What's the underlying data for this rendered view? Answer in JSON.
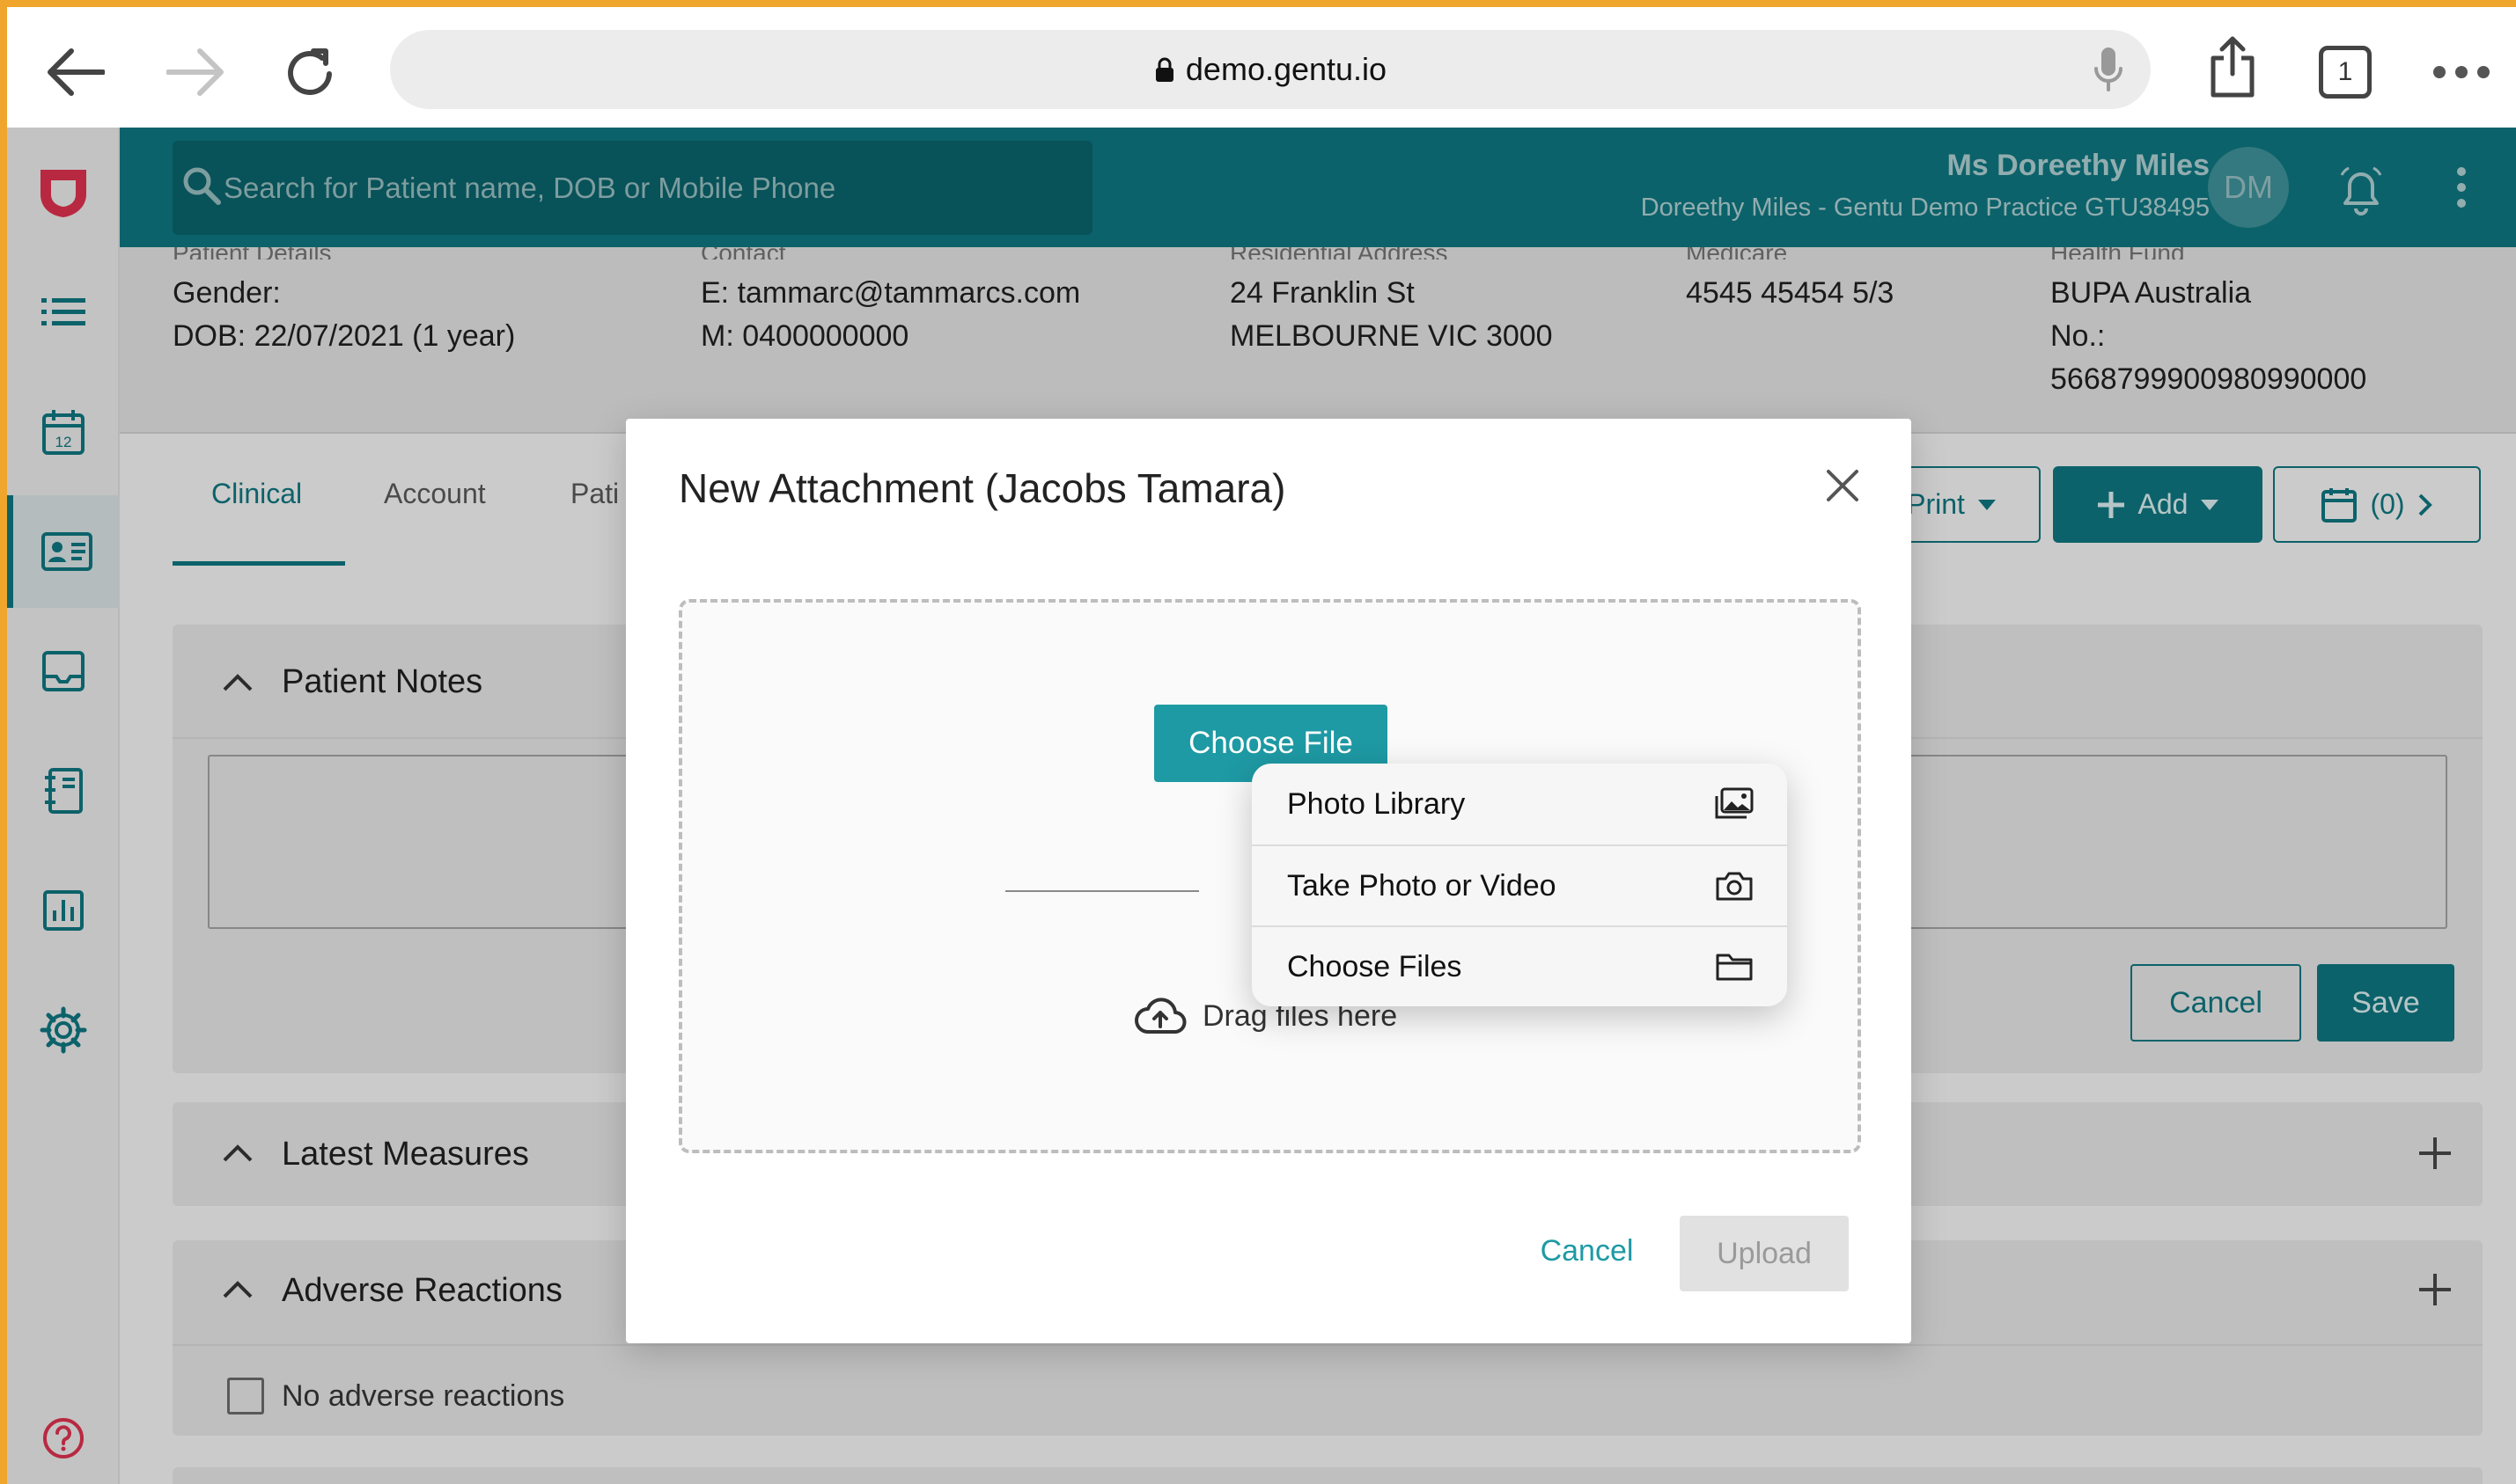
{
  "browser": {
    "url": "demo.gentu.io",
    "tab_count": "1"
  },
  "sidebar": {
    "items": [
      {
        "name": "logo",
        "icon": "gentu-logo"
      },
      {
        "name": "menu",
        "icon": "list-icon"
      },
      {
        "name": "calendar",
        "icon": "calendar-icon",
        "badge": "12"
      },
      {
        "name": "patients",
        "icon": "patient-card-icon",
        "active": true
      },
      {
        "name": "inbox",
        "icon": "inbox-icon"
      },
      {
        "name": "notes",
        "icon": "notebook-icon"
      },
      {
        "name": "reports",
        "icon": "chart-icon"
      },
      {
        "name": "settings",
        "icon": "gear-icon"
      },
      {
        "name": "help",
        "icon": "help-icon"
      }
    ]
  },
  "header": {
    "search_placeholder": "Search for Patient name, DOB or Mobile Phone",
    "user_name": "Ms Doreethy Miles",
    "practice": "Doreethy Miles - Gentu Demo Practice GTU38495",
    "avatar_initials": "DM"
  },
  "patient": {
    "details": {
      "label": "Patient Details",
      "gender": "Gender:",
      "dob": "DOB: 22/07/2021 (1 year)"
    },
    "contact": {
      "label": "Contact",
      "email": "E: tammarc@tammarcs.com",
      "mobile": "M: 0400000000"
    },
    "address": {
      "label": "Residential Address",
      "line1": "24 Franklin St",
      "line2": "MELBOURNE VIC 3000"
    },
    "medicare": {
      "label": "Medicare",
      "number": "4545 45454 5/3"
    },
    "health_fund": {
      "label": "Health Fund",
      "name": "BUPA Australia",
      "no_label": "No.:",
      "number": "5668799900980990000"
    }
  },
  "tabs": [
    {
      "label": "Clinical",
      "active": true
    },
    {
      "label": "Account"
    },
    {
      "label": "Pati"
    }
  ],
  "toolbar": {
    "print_label": "Print",
    "add_label": "Add",
    "appointments_label": "(0)"
  },
  "cards": {
    "patient_notes": {
      "title": "Patient Notes",
      "cancel": "Cancel",
      "save": "Save"
    },
    "latest_measures": {
      "title": "Latest Measures"
    },
    "adverse_reactions": {
      "title": "Adverse Reactions",
      "checkbox_label": "No adverse reactions"
    }
  },
  "modal": {
    "title": "New Attachment (Jacobs Tamara)",
    "choose_file": "Choose File",
    "drag_text": "Drag files here",
    "cancel": "Cancel",
    "upload": "Upload",
    "popover": [
      {
        "label": "Photo Library",
        "icon": "photo-library-icon"
      },
      {
        "label": "Take Photo or Video",
        "icon": "camera-icon"
      },
      {
        "label": "Choose Files",
        "icon": "folder-icon"
      }
    ]
  },
  "colors": {
    "brand_teal": "#0e7079",
    "button_teal": "#1e9aa4",
    "frame_orange": "#f0a52c",
    "logo_red": "#d22f4a"
  }
}
